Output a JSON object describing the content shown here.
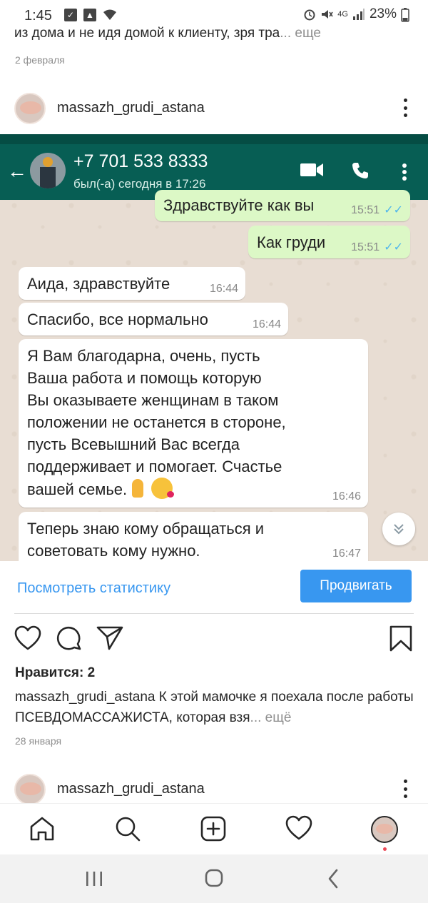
{
  "status_bar": {
    "time": "1:45",
    "network": "4G",
    "battery": "23%"
  },
  "previous_post": {
    "caption_tail": "из дома и не идя домой к клиенту, зря тра",
    "more": "... еще",
    "date": "2 февраля"
  },
  "post": {
    "username": "massazh_grudi_astana",
    "whatsapp": {
      "contact_name": "+7 701 533 8333",
      "last_seen": "был(-а) сегодня в 17:26",
      "messages": [
        {
          "direction": "out",
          "text": "Здравствуйте как вы",
          "time": "15:51"
        },
        {
          "direction": "out",
          "text": "Как груди",
          "time": "15:51"
        },
        {
          "direction": "in",
          "text": "Аида, здравствуйте",
          "time": "16:44"
        },
        {
          "direction": "in",
          "text": "Спасибо, все нормально",
          "time": "16:44"
        },
        {
          "direction": "in",
          "text": "Я Вам благодарна, очень, пусть\nВаша работа и помощь которую\nВы оказываете женщинам в таком\nположении не останется в стороне,\nпусть Всевышний Вас всегда\nподдерживает и помогает. Счастье\nвашей семье.",
          "time": "16:46"
        },
        {
          "direction": "in",
          "text": "Теперь знаю кому обращаться и\nсоветовать кому нужно.",
          "time": "16:47"
        }
      ]
    },
    "view_stats_label": "Посмотреть статистику",
    "promote_label": "Продвигать",
    "likes_text": "Нравится: 2",
    "caption_username": "massazh_grudi_astana",
    "caption_text": " К этой мамочке я поехала после работы ПСЕВДОМАССАЖИСТА, которая взя",
    "caption_more": "... ещё",
    "date": "28 января"
  },
  "next_post": {
    "username": "massazh_grudi_astana"
  },
  "icons": {
    "like": "heart-icon",
    "comment": "comment-icon",
    "share": "send-icon",
    "save": "bookmark-icon",
    "home": "home-icon",
    "search": "search-icon",
    "new_post": "add-icon",
    "activity": "heart-icon",
    "profile": "avatar"
  },
  "colors": {
    "link_blue": "#3897f0",
    "whatsapp_header": "#075e54",
    "outgoing_bubble": "#dcf8c6",
    "read_ticks": "#4fb6ec"
  }
}
